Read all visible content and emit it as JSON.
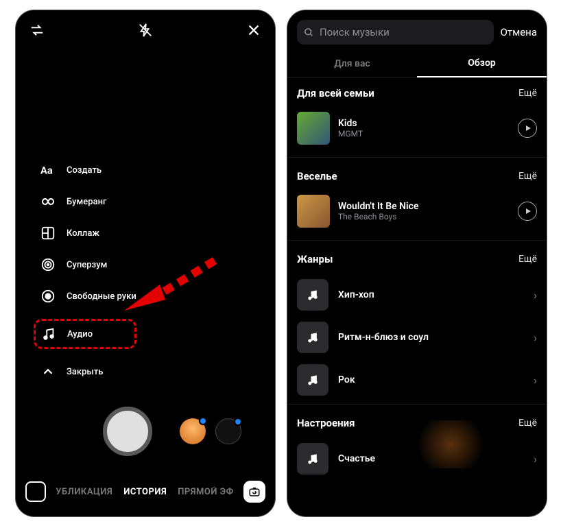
{
  "left": {
    "menu": {
      "create": "Создать",
      "boomerang": "Бумеранг",
      "collage": "Коллаж",
      "superzoom": "Суперзум",
      "handsfree": "Свободные руки",
      "audio": "Аудио",
      "close": "Закрыть"
    },
    "modes": {
      "publication": "УБЛИКАЦИЯ",
      "story": "ИСТОРИЯ",
      "live": "ПРЯМОЙ ЭФ"
    }
  },
  "right": {
    "search": {
      "placeholder": "Поиск музыки",
      "cancel": "Отмена"
    },
    "tabs": {
      "for_you": "Для вас",
      "browse": "Обзор"
    },
    "sections": [
      {
        "title": "Для всей семьи",
        "more": "Ещё",
        "track": {
          "title": "Kids",
          "artist": "MGMT"
        }
      },
      {
        "title": "Веселье",
        "more": "Ещё",
        "track": {
          "title": "Wouldn't It Be Nice",
          "artist": "The Beach Boys"
        }
      },
      {
        "title": "Жанры",
        "more": "Ещё",
        "genres": [
          "Хип-хоп",
          "Ритм-н-блюз и соул",
          "Рок"
        ]
      },
      {
        "title": "Настроения",
        "more": "Ещё",
        "genres": [
          "Счастье"
        ]
      }
    ]
  }
}
